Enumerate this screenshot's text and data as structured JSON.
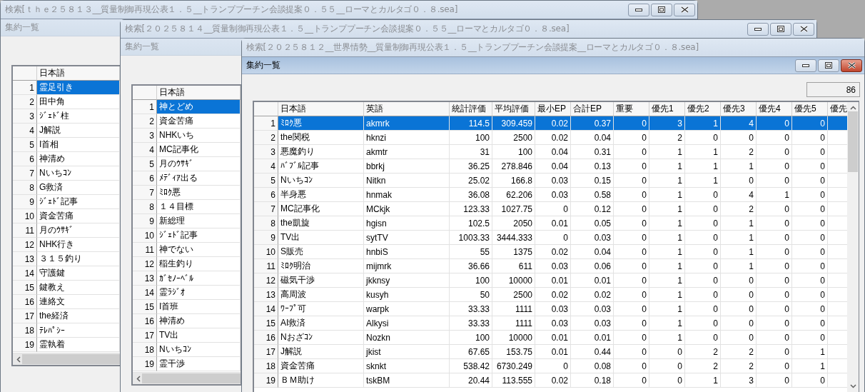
{
  "windows": [
    {
      "title": "検索[ｔｈｅ２５８１３__質量制御再現公表１．５__トランププーチン会談提案０．５５__ローマとカルタゴ０．８.sea]",
      "child": {
        "title": "集約一覧",
        "active": false
      },
      "grid": {
        "columns": [
          "日本語"
        ],
        "rows": [
          {
            "number": "1",
            "cells": [
              "霊足引き"
            ],
            "selected": true
          },
          {
            "number": "2",
            "cells": [
              "田中角"
            ],
            "selected": false
          },
          {
            "number": "3",
            "cells": [
              "ｼﾞｪﾄﾞ柱"
            ],
            "selected": false
          },
          {
            "number": "4",
            "cells": [
              "J解説"
            ],
            "selected": false
          },
          {
            "number": "5",
            "cells": [
              "I首相"
            ],
            "selected": false
          },
          {
            "number": "6",
            "cells": [
              "神清め"
            ],
            "selected": false
          },
          {
            "number": "7",
            "cells": [
              "Nいちｺﾝ"
            ],
            "selected": false
          },
          {
            "number": "8",
            "cells": [
              "G救済"
            ],
            "selected": false
          },
          {
            "number": "9",
            "cells": [
              "ｼﾞｪﾄﾞ記事"
            ],
            "selected": false
          },
          {
            "number": "10",
            "cells": [
              "資金苦痛"
            ],
            "selected": false
          },
          {
            "number": "11",
            "cells": [
              "月のｳｻｷﾞ"
            ],
            "selected": false
          },
          {
            "number": "12",
            "cells": [
              "NHK行き"
            ],
            "selected": false
          },
          {
            "number": "13",
            "cells": [
              "３１５釣り"
            ],
            "selected": false
          },
          {
            "number": "14",
            "cells": [
              "守護鍵"
            ],
            "selected": false
          },
          {
            "number": "15",
            "cells": [
              "鍵教え"
            ],
            "selected": false
          },
          {
            "number": "16",
            "cells": [
              "連絡文"
            ],
            "selected": false
          },
          {
            "number": "17",
            "cells": [
              "the経済"
            ],
            "selected": false
          },
          {
            "number": "18",
            "cells": [
              "ﾃﾚﾊﾟｼｰ"
            ],
            "selected": false
          },
          {
            "number": "19",
            "cells": [
              "霊執着"
            ],
            "selected": false
          }
        ]
      }
    },
    {
      "title": "検索[２０２５８１４__質量制御再現公表１．５__トランププーチン会談提案０．５５__ローマとカルタゴ０．８.sea]",
      "child": {
        "title": "集約一覧",
        "active": false
      },
      "grid": {
        "columns": [
          "日本語"
        ],
        "rows": [
          {
            "number": "1",
            "cells": [
              "神とどめ"
            ],
            "selected": true
          },
          {
            "number": "2",
            "cells": [
              "資金苦痛"
            ],
            "selected": false
          },
          {
            "number": "3",
            "cells": [
              "NHKいち"
            ],
            "selected": false
          },
          {
            "number": "4",
            "cells": [
              "MC記事化"
            ],
            "selected": false
          },
          {
            "number": "5",
            "cells": [
              "月のｳｻｷﾞ"
            ],
            "selected": false
          },
          {
            "number": "6",
            "cells": [
              "ﾒﾃﾞｨｱ出る"
            ],
            "selected": false
          },
          {
            "number": "7",
            "cells": [
              "ﾐﾛｸ悪"
            ],
            "selected": false
          },
          {
            "number": "8",
            "cells": [
              "１４目標"
            ],
            "selected": false
          },
          {
            "number": "9",
            "cells": [
              "新総理"
            ],
            "selected": false
          },
          {
            "number": "10",
            "cells": [
              "ｼﾞｪﾄﾞ記事"
            ],
            "selected": false
          },
          {
            "number": "11",
            "cells": [
              "神でない"
            ],
            "selected": false
          },
          {
            "number": "12",
            "cells": [
              "稲生釣り"
            ],
            "selected": false
          },
          {
            "number": "13",
            "cells": [
              "ｶﾞｾﾉｰﾍﾞﾙ"
            ],
            "selected": false
          },
          {
            "number": "14",
            "cells": [
              "霊ﾗｼﾞｵ"
            ],
            "selected": false
          },
          {
            "number": "15",
            "cells": [
              "I首班"
            ],
            "selected": false
          },
          {
            "number": "16",
            "cells": [
              "神清め"
            ],
            "selected": false
          },
          {
            "number": "17",
            "cells": [
              "TV出"
            ],
            "selected": false
          },
          {
            "number": "18",
            "cells": [
              "Nいちｺﾝ"
            ],
            "selected": false
          },
          {
            "number": "19",
            "cells": [
              "霊干渉"
            ],
            "selected": false
          }
        ]
      }
    },
    {
      "title": "検索[２０２５８１２__世界情勢__質量制御再現公表１．５__トランププーチン会談提案__ローマとカルタゴ０．８.sea]",
      "child": {
        "title": "集約一覧",
        "active": true
      },
      "count": "86",
      "grid": {
        "columns": [
          "日本語",
          "英語",
          "統計評価",
          "平均評価",
          "最小EP",
          "合計EP",
          "重要",
          "優先1",
          "優先2",
          "優先3",
          "優先4",
          "優先5",
          "優先"
        ],
        "rows": [
          {
            "number": "1",
            "cells": [
              "ﾐﾛｸ悪",
              "akmrk",
              "114.5",
              "309.459",
              "0.02",
              "0.37",
              "0",
              "3",
              "1",
              "4",
              "0",
              "0"
            ],
            "selected": true
          },
          {
            "number": "2",
            "cells": [
              "the関税",
              "hknzi",
              "100",
              "2500",
              "0.02",
              "0.04",
              "0",
              "2",
              "0",
              "0",
              "0",
              "0"
            ],
            "selected": false
          },
          {
            "number": "3",
            "cells": [
              "悪魔釣り",
              "akmtr",
              "31",
              "100",
              "0.04",
              "0.31",
              "0",
              "1",
              "1",
              "2",
              "0",
              "0"
            ],
            "selected": false
          },
          {
            "number": "4",
            "cells": [
              "ﾊﾞﾌﾞﾙ記事",
              "bbrkj",
              "36.25",
              "278.846",
              "0.04",
              "0.13",
              "0",
              "1",
              "1",
              "1",
              "0",
              "0"
            ],
            "selected": false
          },
          {
            "number": "5",
            "cells": [
              "Nいちｺﾝ",
              "Nitkn",
              "25.02",
              "166.8",
              "0.03",
              "0.15",
              "0",
              "1",
              "1",
              "0",
              "0",
              "0"
            ],
            "selected": false
          },
          {
            "number": "6",
            "cells": [
              "半身悪",
              "hnmak",
              "36.08",
              "62.206",
              "0.03",
              "0.58",
              "0",
              "1",
              "0",
              "4",
              "1",
              "0"
            ],
            "selected": false
          },
          {
            "number": "7",
            "cells": [
              "MC記事化",
              "MCkjk",
              "123.33",
              "1027.75",
              "0",
              "0.12",
              "0",
              "1",
              "0",
              "2",
              "0",
              "0"
            ],
            "selected": false
          },
          {
            "number": "8",
            "cells": [
              "the凱旋",
              "hgisn",
              "102.5",
              "2050",
              "0.01",
              "0.05",
              "0",
              "1",
              "0",
              "1",
              "0",
              "0"
            ],
            "selected": false
          },
          {
            "number": "9",
            "cells": [
              "TV出",
              "sytTV",
              "1003.33",
              "3444.333",
              "0",
              "0.03",
              "0",
              "1",
              "0",
              "1",
              "0",
              "0"
            ],
            "selected": false
          },
          {
            "number": "10",
            "cells": [
              "S販売",
              "hnbiS",
              "55",
              "1375",
              "0.02",
              "0.04",
              "0",
              "1",
              "0",
              "1",
              "0",
              "0"
            ],
            "selected": false
          },
          {
            "number": "11",
            "cells": [
              "ﾐﾛｸ明治",
              "mijmrk",
              "36.66",
              "611",
              "0.03",
              "0.06",
              "0",
              "1",
              "0",
              "1",
              "0",
              "0"
            ],
            "selected": false
          },
          {
            "number": "12",
            "cells": [
              "磁気干渉",
              "jkknsy",
              "100",
              "10000",
              "0.01",
              "0.01",
              "0",
              "1",
              "0",
              "0",
              "0",
              "0"
            ],
            "selected": false
          },
          {
            "number": "13",
            "cells": [
              "高周波",
              "kusyh",
              "50",
              "2500",
              "0.02",
              "0.02",
              "0",
              "1",
              "0",
              "0",
              "0",
              "0"
            ],
            "selected": false
          },
          {
            "number": "14",
            "cells": [
              "ﾜｰﾌﾟ可",
              "warpk",
              "33.33",
              "1111",
              "0.03",
              "0.03",
              "0",
              "1",
              "0",
              "0",
              "0",
              "0"
            ],
            "selected": false
          },
          {
            "number": "15",
            "cells": [
              "AI救済",
              "Alkysi",
              "33.33",
              "1111",
              "0.03",
              "0.03",
              "0",
              "1",
              "0",
              "0",
              "0",
              "0"
            ],
            "selected": false
          },
          {
            "number": "16",
            "cells": [
              "Nおざｺﾝ",
              "Nozkn",
              "100",
              "10000",
              "0.01",
              "0.01",
              "0",
              "1",
              "0",
              "0",
              "0",
              "0"
            ],
            "selected": false
          },
          {
            "number": "17",
            "cells": [
              "J解説",
              "jkist",
              "67.65",
              "153.75",
              "0.01",
              "0.44",
              "0",
              "0",
              "2",
              "2",
              "0",
              "1"
            ],
            "selected": false
          },
          {
            "number": "18",
            "cells": [
              "資金苦痛",
              "sknkt",
              "538.42",
              "6730.249",
              "0",
              "0.08",
              "0",
              "0",
              "2",
              "2",
              "0",
              "1"
            ],
            "selected": false
          },
          {
            "number": "19",
            "cells": [
              "ＢＭ助け",
              "tskBM",
              "20.44",
              "113.555",
              "0.02",
              "0.18",
              "0",
              "0",
              "1",
              "3",
              "0",
              "0"
            ],
            "selected": false
          }
        ]
      }
    }
  ]
}
